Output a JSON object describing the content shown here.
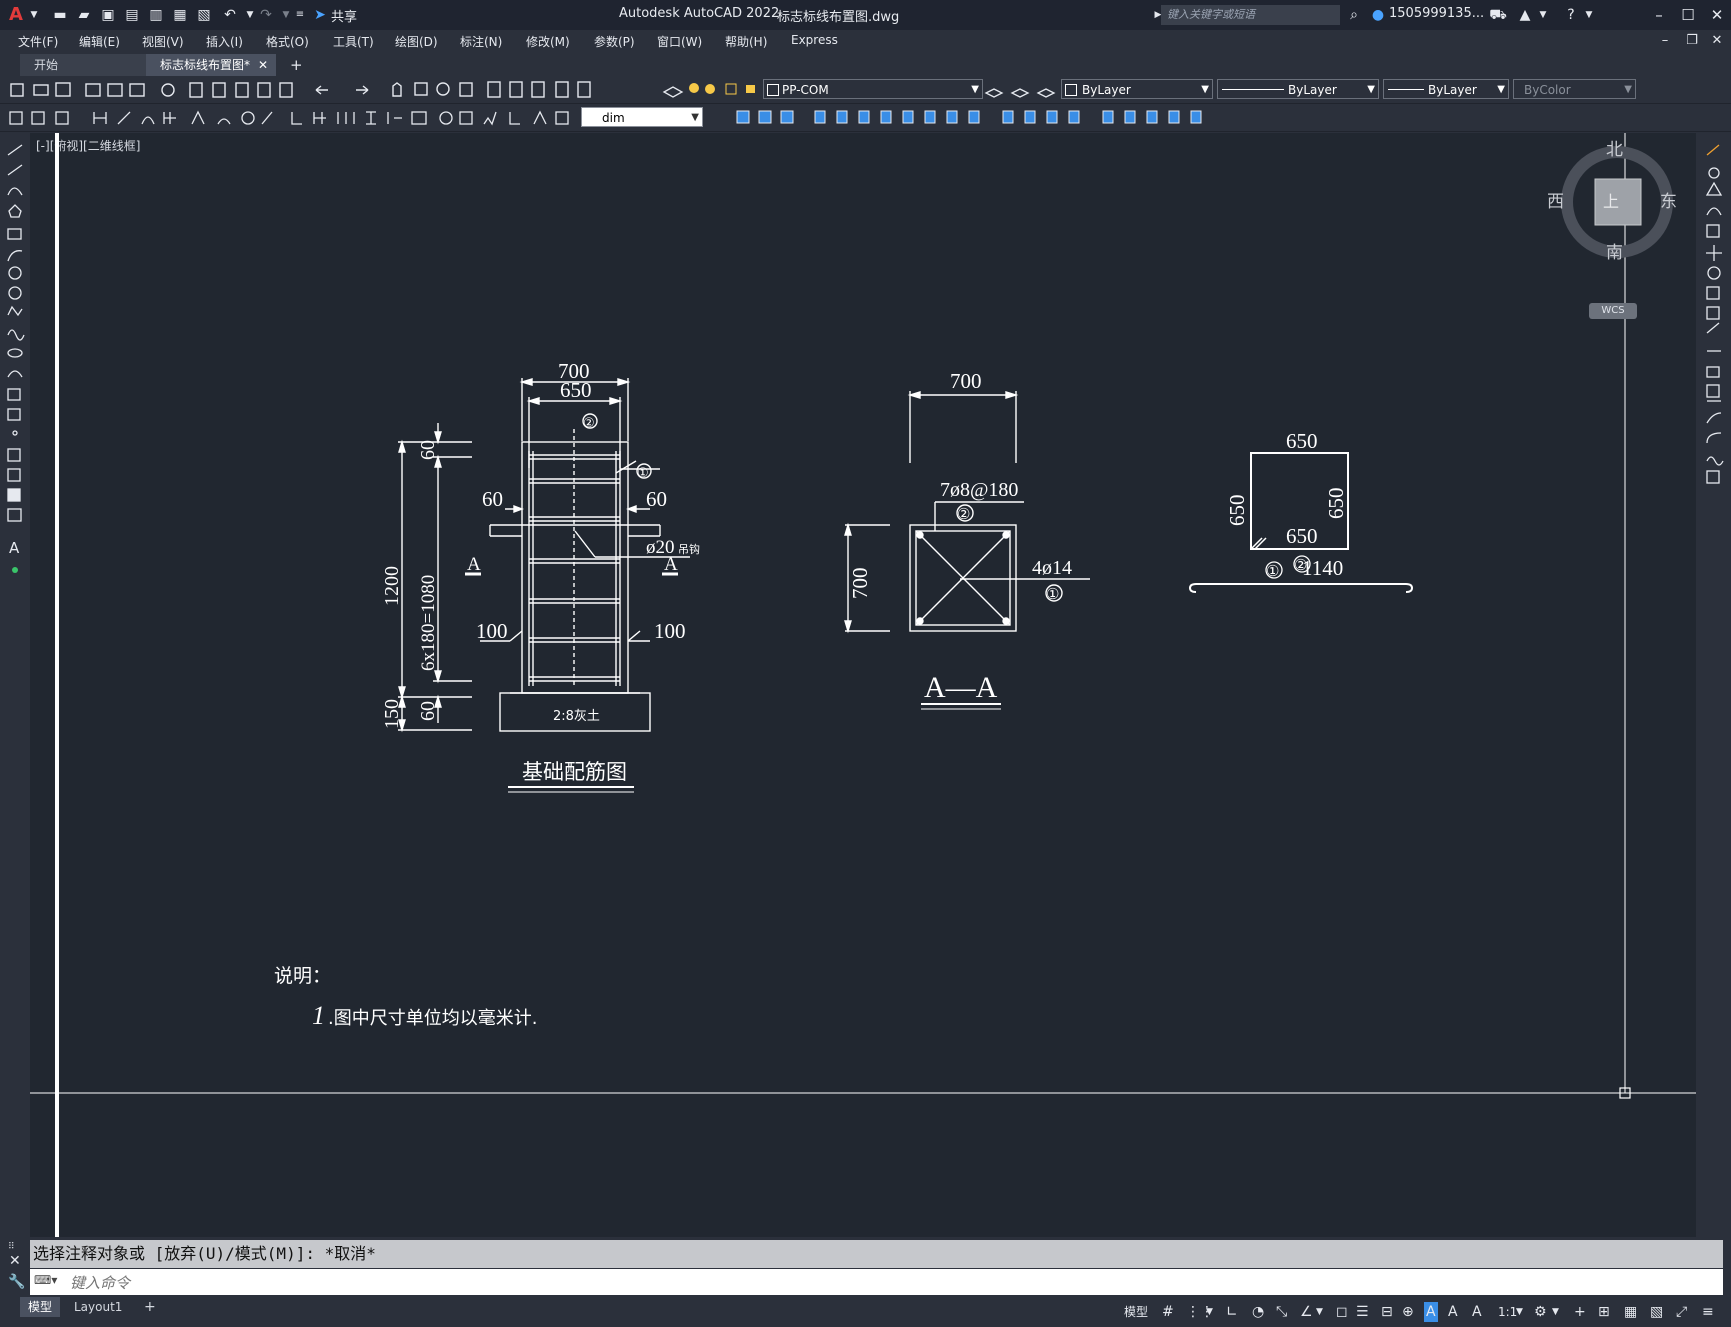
{
  "app": {
    "title": "Autodesk AutoCAD 2022",
    "filename": "标志标线布置图.dwg",
    "share_label": "共享",
    "search_placeholder": "键入关键字或短语",
    "user": "1505999135...",
    "app_icon_letter": "A"
  },
  "menu": [
    "文件(F)",
    "编辑(E)",
    "视图(V)",
    "插入(I)",
    "格式(O)",
    "工具(T)",
    "绘图(D)",
    "标注(N)",
    "修改(M)",
    "参数(P)",
    "窗口(W)",
    "帮助(H)",
    "Express"
  ],
  "tabs": [
    {
      "label": "开始",
      "active": false
    },
    {
      "label": "标志标线布置图*",
      "active": true
    }
  ],
  "toolbar": {
    "layer": "PP-COM",
    "color": "ByLayer",
    "linetype": "ByLayer",
    "lineweight": "ByLayer",
    "plotstyle": "ByColor",
    "dimstyle": "dim"
  },
  "viewport": {
    "label": "[-][俯视][二维线框]"
  },
  "viewcube": {
    "north": "北",
    "south": "南",
    "east": "东",
    "west": "西",
    "face": "上",
    "wcs": "WCS"
  },
  "drawing": {
    "elevation": {
      "dim_top_outer": "700",
      "dim_top_inner": "650",
      "marker_2": "②",
      "marker_1": "①",
      "dim_60_left": "60",
      "dim_60_right": "60",
      "rebar_label": "ø20",
      "rebar_suffix": "吊钩",
      "section_a_left": "A",
      "section_a_right": "A",
      "dim_100_left": "100",
      "dim_100_right": "100",
      "dim_60_top": "60",
      "dim_1200": "1200",
      "dim_6x180": "6x180=1080",
      "dim_150": "150",
      "dim_60_bottom": "60",
      "base_label": "2:8灰土",
      "title": "基础配筋图"
    },
    "section": {
      "dim_top": "700",
      "stirrup": "7ø8@180",
      "marker_2": "②",
      "dim_left": "700",
      "rebar": "4ø14",
      "marker_1": "①",
      "title": "A—A"
    },
    "stirrup_detail": {
      "top": "650",
      "left": "650",
      "right": "650",
      "bottom": "650",
      "marker": "②"
    },
    "bar_detail": {
      "marker": "①",
      "length": "1140"
    },
    "notes": {
      "heading": "说明：",
      "num": "1",
      "text": ".图中尺寸单位均以毫米计."
    }
  },
  "command": {
    "history": "选择注释对象或 [放弃(U)/模式(M)]: *取消*",
    "placeholder": "键入命令"
  },
  "status": {
    "tabs": [
      {
        "label": "模型",
        "active": true
      },
      {
        "label": "Layout1",
        "active": false
      }
    ],
    "model_label": "模型",
    "scale": "1:1"
  }
}
